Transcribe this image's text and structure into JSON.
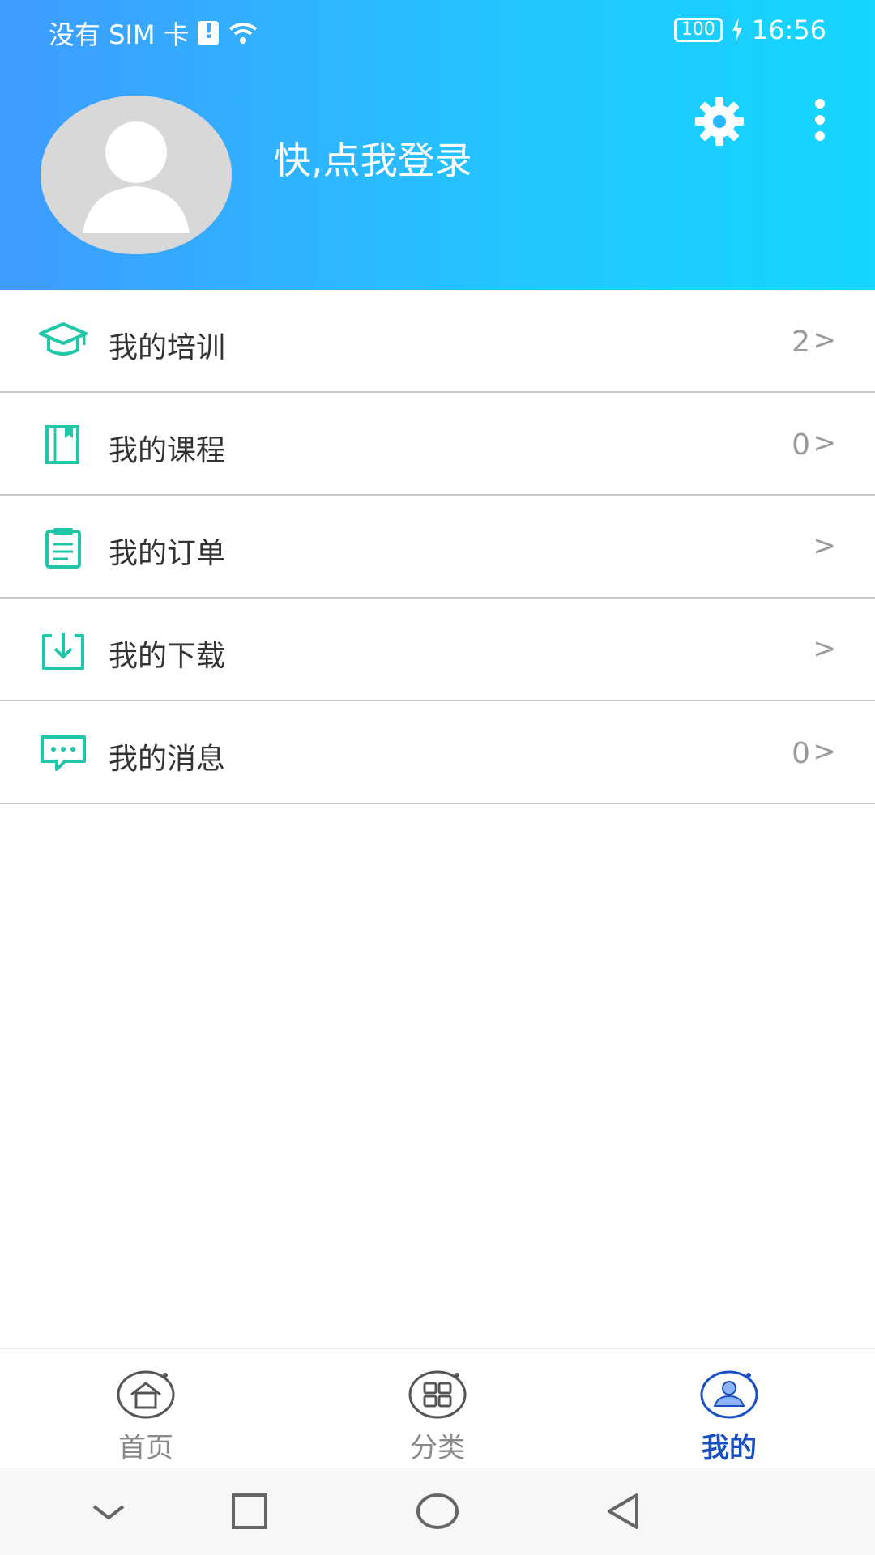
{
  "status_bar": {
    "carrier": "没有 SIM 卡",
    "battery": "100",
    "time": "16:56"
  },
  "profile": {
    "login_prompt": "快,点我登录"
  },
  "icons": {
    "settings": "gear-icon",
    "more": "more-vertical-icon"
  },
  "menu": {
    "items": [
      {
        "label": "我的培训",
        "count": "2",
        "icon": "graduation-cap-icon"
      },
      {
        "label": "我的课程",
        "count": "0",
        "icon": "book-icon"
      },
      {
        "label": "我的订单",
        "count": "",
        "icon": "clipboard-icon"
      },
      {
        "label": "我的下载",
        "count": "",
        "icon": "download-icon"
      },
      {
        "label": "我的消息",
        "count": "0",
        "icon": "chat-bubble-icon"
      }
    ],
    "arrow": ">"
  },
  "tabs": [
    {
      "label": "首页",
      "icon": "home-icon",
      "active": false
    },
    {
      "label": "分类",
      "icon": "grid-icon",
      "active": false
    },
    {
      "label": "我的",
      "icon": "user-icon",
      "active": true
    }
  ],
  "colors": {
    "accent": "#1fc6a8",
    "tab_active": "#1a4fc2",
    "tab_inactive": "#8a8a8a",
    "header_start": "#3f9bff",
    "header_end": "#14d6ff"
  }
}
